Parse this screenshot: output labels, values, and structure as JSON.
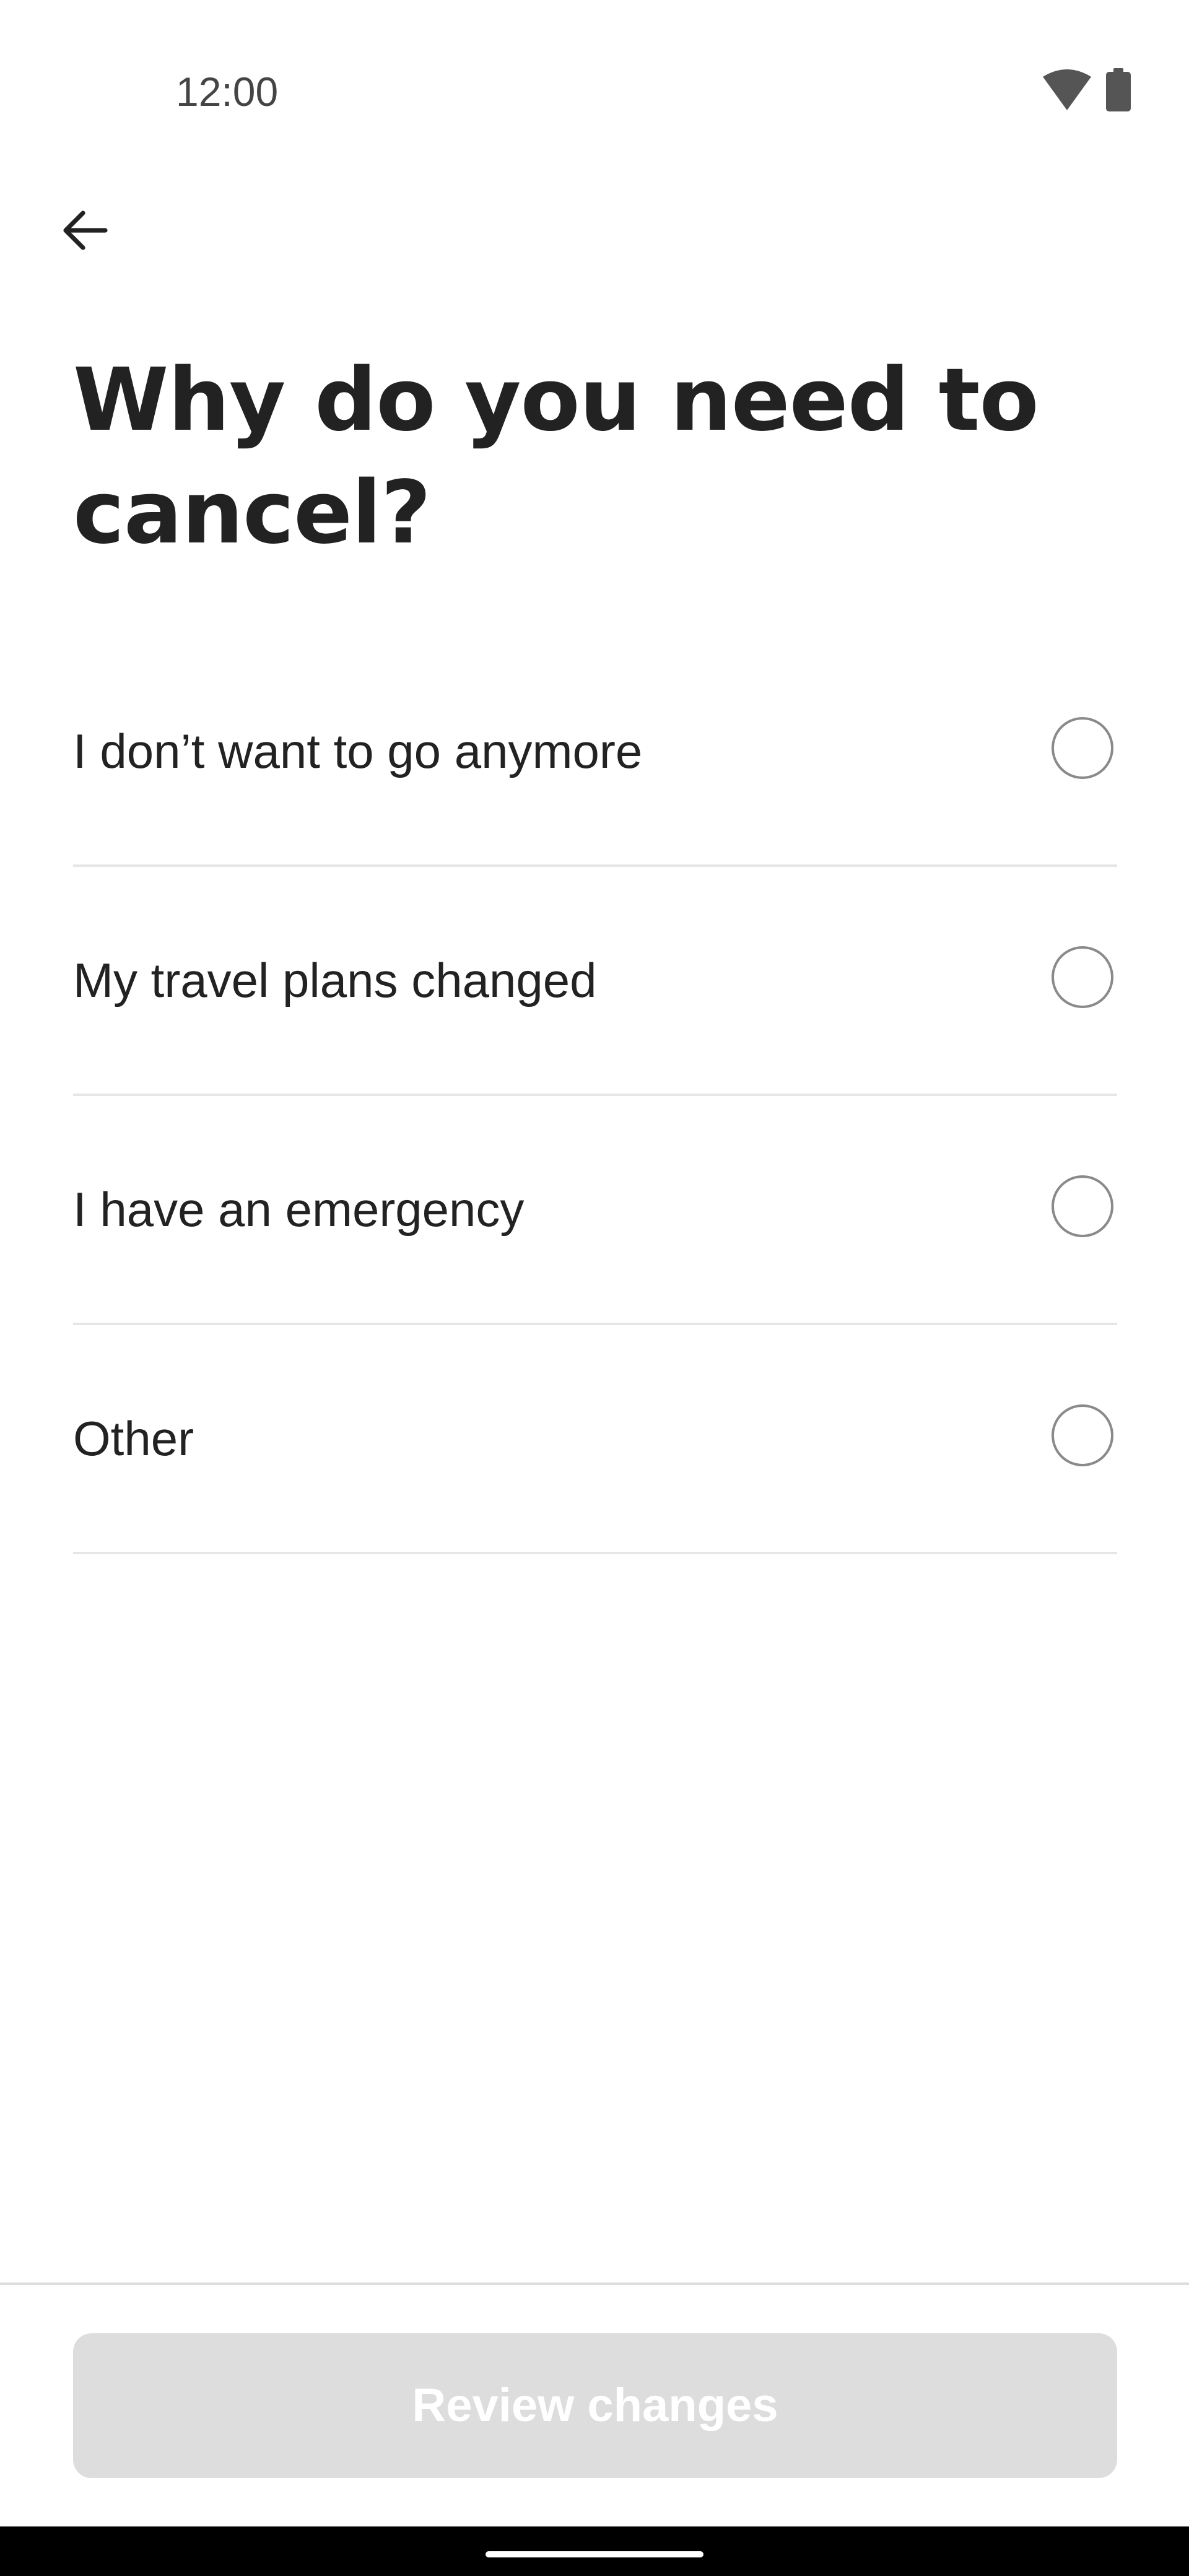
{
  "status_bar": {
    "time": "12:00"
  },
  "icons": {
    "back": "arrow-left-icon",
    "wifi": "wifi-icon",
    "battery": "battery-icon"
  },
  "header": {
    "title": "Why do you need to cancel?"
  },
  "options": [
    {
      "label": "I don’t want to go anymore",
      "selected": false
    },
    {
      "label": "My travel plans changed",
      "selected": false
    },
    {
      "label": "I have an emergency",
      "selected": false
    },
    {
      "label": "Other",
      "selected": false
    }
  ],
  "footer": {
    "review_label": "Review changes",
    "review_enabled": false
  },
  "colors": {
    "text": "#222222",
    "divider": "#e6e6e6",
    "disabled_button_bg": "#dddddd",
    "disabled_button_text": "#ffffff"
  }
}
